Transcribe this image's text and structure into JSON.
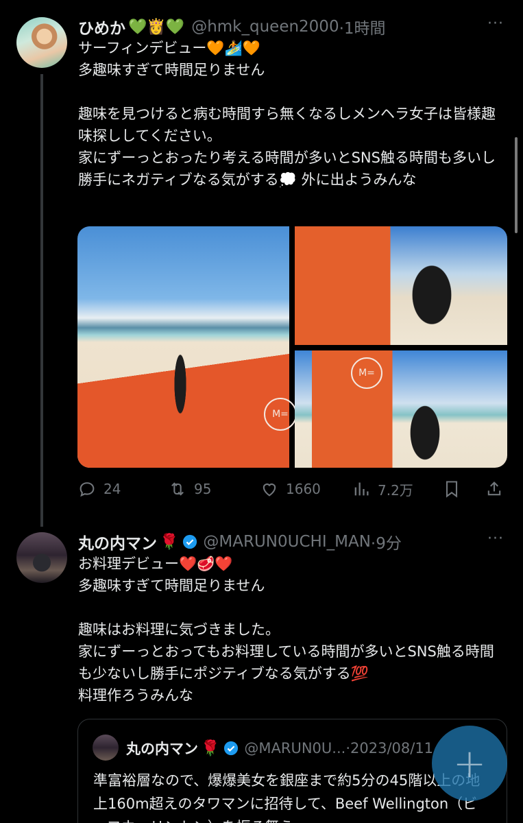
{
  "tweet1": {
    "name": "ひめか",
    "name_emojis": "💚👸💚",
    "handle": "@hmk_queen2000",
    "time": "·1時間",
    "more": "···",
    "text": "サーフィンデビュー🧡🏄🧡\n多趣味すぎて時間足りません\n\n趣味を見つけると病む時間すら無くなるしメンヘラ女子は皆様趣味探ししてください。\n家にずーっとおったり考える時間が多いとSNS触る時間も多いし勝手にネガティブなる気がする💭 外に出ようみんな",
    "photos": [
      "beach-surfboard-photo",
      "surfboard-portrait-photo",
      "surfboard-pose-photo"
    ],
    "board_logo": "M=",
    "stats": {
      "replies": "24",
      "reposts": "95",
      "likes": "1660",
      "views": "7.2万"
    }
  },
  "tweet2": {
    "name": "丸の内マン",
    "name_emoji": "🌹",
    "verified": true,
    "handle": "@MARUN0UCHI_MAN",
    "time": "·9分",
    "more": "···",
    "text": "お料理デビュー❤️🥩❤️\n多趣味すぎて時間足りません\n\n趣味はお料理に気づきました。\n家にずーっとおってもお料理している時間が多いとSNS触る時間も少ないし勝手にポジティブなる気がする💯\n料理作ろうみんな"
  },
  "quote": {
    "name": "丸の内マン",
    "name_emoji": "🌹",
    "handle": "@MARUN0U...",
    "date": "·2023/08/11",
    "text": "準富裕層なので、爆爆美女を銀座まで約5分の45階以上の地上160m超えのタワマンに招待して、Beef Wellington（ビーフウェリントン）を振る舞う"
  },
  "fab": {
    "icon": "plus-icon",
    "label": "+"
  },
  "colors": {
    "accent": "#1d9bf0",
    "muted": "#71767b",
    "text": "#e7e9ea",
    "background": "#000000"
  }
}
